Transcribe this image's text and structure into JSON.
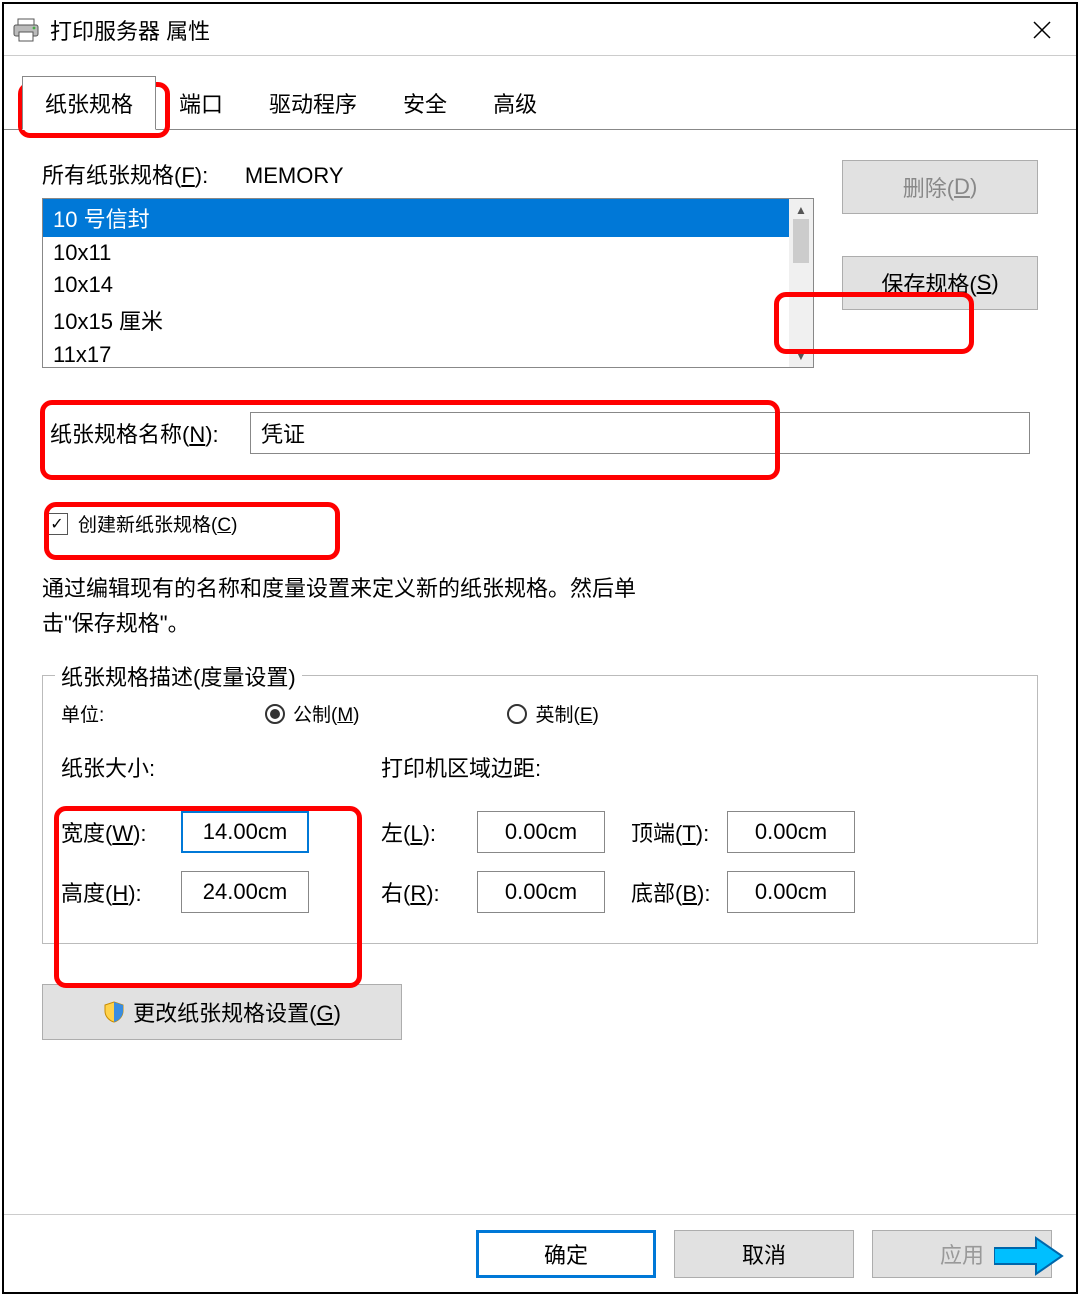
{
  "title": "打印服务器 属性",
  "tabs": [
    "纸张规格",
    "端口",
    "驱动程序",
    "安全",
    "高级"
  ],
  "active_tab": 0,
  "forms_label_prefix": "所有纸张规格(",
  "forms_label_acc": "F",
  "forms_label_suffix": "):",
  "forms_source": "MEMORY",
  "list_items": [
    "10 号信封",
    "10x11",
    "10x14",
    "10x15 厘米",
    "11x17"
  ],
  "selected_index": 0,
  "delete_btn": {
    "pre": "删除(",
    "acc": "D",
    "post": ")"
  },
  "save_btn": {
    "pre": "保存规格(",
    "acc": "S",
    "post": ")"
  },
  "name_label": {
    "pre": "纸张规格名称(",
    "acc": "N",
    "post": "):"
  },
  "name_value": "凭证",
  "create_new": {
    "pre": "创建新纸张规格(",
    "acc": "C",
    "post": ")",
    "checked": true
  },
  "help_line1": "通过编辑现有的名称和度量设置来定义新的纸张规格。然后单",
  "help_line2": "击\"保存规格\"。",
  "fieldset_legend": "纸张规格描述(度量设置)",
  "units_label": "单位:",
  "metric": {
    "pre": "公制(",
    "acc": "M",
    "post": ")"
  },
  "english": {
    "pre": "英制(",
    "acc": "E",
    "post": ")"
  },
  "units_selected": "metric",
  "paper_size_head": "纸张大小:",
  "width": {
    "pre": "宽度(",
    "acc": "W",
    "post": "):",
    "value": "14.00cm"
  },
  "height": {
    "pre": "高度(",
    "acc": "H",
    "post": "):",
    "value": "24.00cm"
  },
  "margins_head": "打印机区域边距:",
  "left": {
    "pre": "左(",
    "acc": "L",
    "post": "):",
    "value": "0.00cm"
  },
  "right": {
    "pre": "右(",
    "acc": "R",
    "post": "):",
    "value": "0.00cm"
  },
  "top": {
    "pre": "顶端(",
    "acc": "T",
    "post": "):",
    "value": "0.00cm"
  },
  "bottom": {
    "pre": "底部(",
    "acc": "B",
    "post": "):",
    "value": "0.00cm"
  },
  "change_btn": {
    "pre": "更改纸张规格设置(",
    "acc": "G",
    "post": ")"
  },
  "ok_btn": "确定",
  "cancel_btn": "取消",
  "apply_btn": "应用"
}
